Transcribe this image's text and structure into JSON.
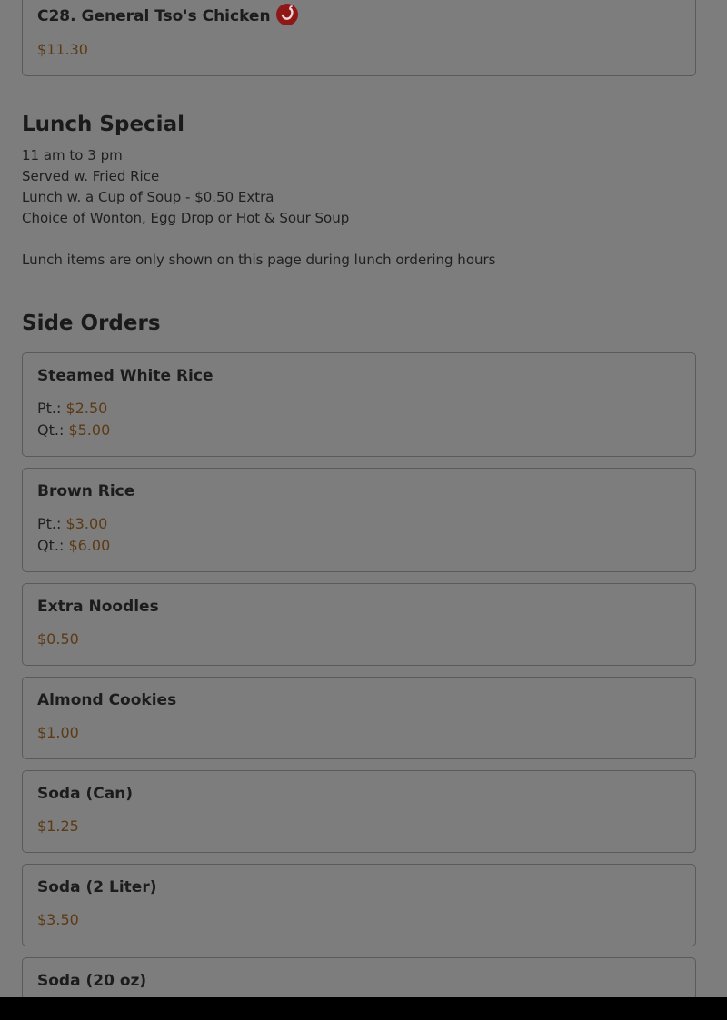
{
  "top_item": {
    "name": "C28. General Tso's Chicken",
    "price": "$11.30",
    "icon": "spicy-pepper-icon"
  },
  "lunch_special": {
    "title": "Lunch Special",
    "lines": [
      "11 am to 3 pm",
      "Served w. Fried Rice",
      "Lunch w. a Cup of Soup - $0.50 Extra",
      "Choice of Wonton, Egg Drop or Hot & Sour Soup"
    ],
    "note": "Lunch items are only shown on this page during lunch ordering hours"
  },
  "side_orders": {
    "title": "Side Orders",
    "items": [
      {
        "name": "Steamed White Rice",
        "sizes": [
          {
            "label": "Pt.:",
            "price": "$2.50"
          },
          {
            "label": "Qt.:",
            "price": "$5.00"
          }
        ]
      },
      {
        "name": "Brown Rice",
        "sizes": [
          {
            "label": "Pt.:",
            "price": "$3.00"
          },
          {
            "label": "Qt.:",
            "price": "$6.00"
          }
        ]
      },
      {
        "name": "Extra Noodles",
        "price": "$0.50"
      },
      {
        "name": "Almond Cookies",
        "price": "$1.00"
      },
      {
        "name": "Soda (Can)",
        "price": "$1.25"
      },
      {
        "name": "Soda (2 Liter)",
        "price": "$3.50"
      },
      {
        "name": "Soda (20 oz)"
      }
    ]
  },
  "colors": {
    "background": "#7d7d7d",
    "price": "#5c3a14",
    "spicy_icon": "#8e1717"
  }
}
